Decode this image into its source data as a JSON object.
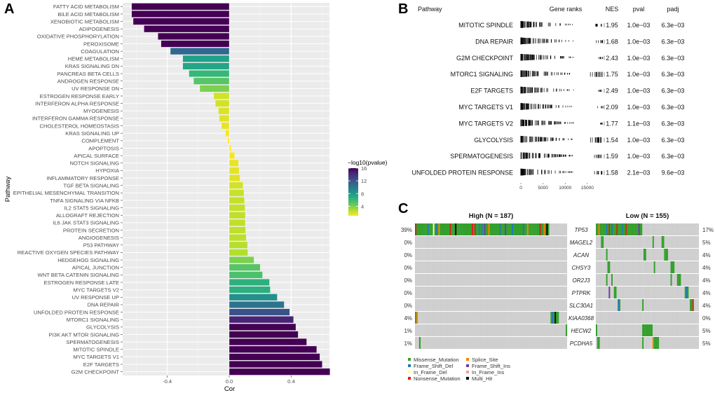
{
  "chart_data": [
    {
      "panel": "A",
      "type": "bar",
      "orientation": "horizontal",
      "xlabel": "Cor",
      "ylabel": "Pathway",
      "xlim": [
        -0.69,
        0.72
      ],
      "xticks": [
        -0.4,
        0.0,
        0.4
      ],
      "xtick_labels": [
        "-0.4",
        "0.0",
        "0.4"
      ],
      "grid": true,
      "legend": {
        "title": "−log10(pvalue)",
        "position": "right",
        "ticks": [
          4,
          8,
          12,
          16
        ],
        "range": [
          1,
          16
        ],
        "colormap": "viridis"
      },
      "categories": [
        "FATTY ACID METABOLISM",
        "BILE ACID METABOLISM",
        "XENOBIOTIC METABOLISM",
        "ADIPOGENESIS",
        "OXIDATIVE PHOSPHORYLATION",
        "PEROXISOME",
        "COAGULATION",
        "HEME METABOLISM",
        "KRAS SIGNALING DN",
        "PANCREAS BETA CELLS",
        "ANDROGEN RESPONSE",
        "UV RESPONSE DN",
        "ESTROGEN RESPONSE EARLY",
        "INTERFERON ALPHA RESPONSE",
        "MYOGENESIS",
        "INTERFERON GAMMA RESPONSE",
        "CHOLESTEROL HOMEOSTASIS",
        "KRAS SIGNALING UP",
        "COMPLEMENT",
        "APOPTOSIS",
        "APICAL SURFACE",
        "NOTCH SIGNALING",
        "HYPOXIA",
        "INFLAMMATORY RESPONSE",
        "TGF BETA SIGNALING",
        "EPITHELIAL MESENCHYMAL TRANSITION",
        "TNFA SIGNALING VIA NFKB",
        "IL2 STAT5 SIGNALING",
        "ALLOGRAFT REJECTION",
        "IL6 JAK STAT3 SIGNALING",
        "PROTEIN SECRETION",
        "ANGIOGENESIS",
        "P53 PATHWAY",
        "REACTIVE OXYGEN SPECIES PATHWAY",
        "HEDGEHOG SIGNALING",
        "APICAL JUNCTION",
        "WNT BETA CATENIN SIGNALING",
        "ESTROGEN RESPONSE LATE",
        "MYC TARGETS V2",
        "UV RESPONSE UP",
        "DNA REPAIR",
        "UNFOLDED PROTEIN RESPONSE",
        "MTORC1 SIGNALING",
        "GLYCOLYSIS",
        "PI3K AKT MTOR SIGNALING",
        "SPERMATOGENESIS",
        "MITOTIC SPINDLE",
        "MYC TARGETS V1",
        "E2F TARGETS",
        "G2M CHECKPOINT"
      ],
      "values": [
        -0.63,
        -0.63,
        -0.62,
        -0.55,
        -0.46,
        -0.44,
        -0.38,
        -0.3,
        -0.3,
        -0.26,
        -0.23,
        -0.19,
        -0.1,
        -0.09,
        -0.07,
        -0.065,
        -0.05,
        -0.025,
        -0.01,
        0.012,
        0.035,
        0.06,
        0.065,
        0.07,
        0.09,
        0.095,
        0.098,
        0.102,
        0.104,
        0.104,
        0.106,
        0.11,
        0.118,
        0.12,
        0.16,
        0.2,
        0.215,
        0.26,
        0.265,
        0.31,
        0.355,
        0.39,
        0.415,
        0.43,
        0.445,
        0.5,
        0.565,
        0.585,
        0.6,
        0.65
      ],
      "neglog10p": [
        16,
        16,
        16,
        16,
        16,
        16,
        11,
        7.5,
        7.2,
        6,
        5,
        4,
        2,
        2,
        1.8,
        1.7,
        1.5,
        1.1,
        1,
        1,
        1.2,
        1.5,
        1.6,
        1.7,
        2,
        2.2,
        2.3,
        2.3,
        2.4,
        2.4,
        2.4,
        2.5,
        2.6,
        2.7,
        4,
        5,
        5.3,
        6.5,
        6.6,
        8.5,
        10.3,
        12.2,
        14.5,
        16,
        16,
        16,
        16,
        16,
        16,
        16
      ]
    },
    {
      "panel": "B",
      "type": "table",
      "columns": [
        "Pathway",
        "Gene ranks",
        "NES",
        "pval",
        "padj"
      ],
      "rank_axis": {
        "ticks": [
          0,
          5000,
          10000,
          15000
        ],
        "tick_labels": [
          "0",
          "5000",
          "10000",
          "15000"
        ],
        "max": 18500
      },
      "rows": [
        {
          "pathway": "MITOTIC SPINDLE",
          "nes": "1.95",
          "pval": "1.0e−03",
          "padj": "6.3e−03",
          "density": "front",
          "tail": 0.35
        },
        {
          "pathway": "DNA REPAIR",
          "nes": "1.68",
          "pval": "1.0e−03",
          "padj": "6.3e−03",
          "density": "front",
          "tail": 0.35
        },
        {
          "pathway": "G2M CHECKPOINT",
          "nes": "2.43",
          "pval": "1.0e−03",
          "padj": "6.3e−03",
          "density": "sparse-front",
          "tail": 0.15
        },
        {
          "pathway": "MTORC1 SIGNALING",
          "nes": "1.75",
          "pval": "1.0e−03",
          "padj": "6.3e−03",
          "density": "front",
          "tail": 0.9
        },
        {
          "pathway": "E2F TARGETS",
          "nes": "2.49",
          "pval": "1.0e−03",
          "padj": "6.3e−03",
          "density": "sparse-front",
          "tail": 0.15
        },
        {
          "pathway": "MYC TARGETS V1",
          "nes": "2.09",
          "pval": "1.0e−03",
          "padj": "6.3e−03",
          "density": "sparse-front",
          "tail": 0.15
        },
        {
          "pathway": "MYC TARGETS V2",
          "nes": "1.77",
          "pval": "1.1e−03",
          "padj": "6.3e−03",
          "density": "sparse",
          "tail": 0.1
        },
        {
          "pathway": "GLYCOLYSIS",
          "nes": "1.54",
          "pval": "1.0e−03",
          "padj": "6.3e−03",
          "density": "front",
          "tail": 1.0
        },
        {
          "pathway": "SPERMATOGENESIS",
          "nes": "1.59",
          "pval": "1.0e−03",
          "padj": "6.3e−03",
          "density": "even",
          "tail": 0.5
        },
        {
          "pathway": "UNFOLDED PROTEIN RESPONSE",
          "nes": "1.58",
          "pval": "2.1e−03",
          "padj": "9.6e−03",
          "density": "front",
          "tail": 0.5
        }
      ]
    },
    {
      "panel": "C",
      "type": "heatmap",
      "subtype": "oncoplot",
      "groups": [
        {
          "title": "High (N = 187)",
          "percent_side": "left"
        },
        {
          "title": "Low (N = 155)",
          "percent_side": "right"
        }
      ],
      "genes": [
        "TP53",
        "MAGEL2",
        "ACAN",
        "CHSY3",
        "OR2J3",
        "PTPRK",
        "SLC30A1",
        "KIAA0368",
        "HECW2",
        "PCDHA5"
      ],
      "high_percent": [
        "39%",
        "0%",
        "0%",
        "0%",
        "0%",
        "0%",
        "0%",
        "4%",
        "1%",
        "1%"
      ],
      "low_percent": [
        "17%",
        "5%",
        "4%",
        "4%",
        "4%",
        "4%",
        "4%",
        "0%",
        "5%",
        "5%"
      ],
      "legend": [
        {
          "label": "Missense_Mutation",
          "color": "#33a02c"
        },
        {
          "label": "Splice_Site",
          "color": "#ff7f00"
        },
        {
          "label": "Frame_Shift_Del",
          "color": "#1f78b4"
        },
        {
          "label": "Frame_Shift_Ins",
          "color": "#6a3d9a"
        },
        {
          "label": "In_Frame_Del",
          "color": "#ffff99"
        },
        {
          "label": "In_Frame_Ins",
          "color": "#fb9a99"
        },
        {
          "label": "Nonsense_Mutation",
          "color": "#e31a1c"
        },
        {
          "label": "Multi_Hit",
          "color": "#000000"
        }
      ]
    }
  ],
  "panels": {
    "a": "A",
    "b": "B",
    "c": "C"
  }
}
